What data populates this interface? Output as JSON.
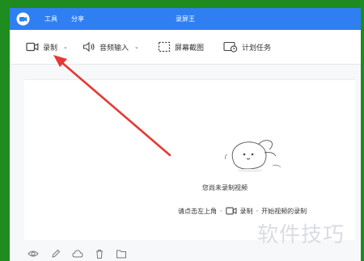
{
  "titlebar": {
    "menu": [
      "工具",
      "分享"
    ],
    "title": "录屏王"
  },
  "toolbar": {
    "record_label": "录制",
    "audio_label": "音频输入",
    "screenshot_label": "屏幕截图",
    "schedule_label": "计划任务"
  },
  "empty_state": {
    "title": "您尚未录制视频",
    "hint_prefix": "请点击左上角",
    "hint_button": "录制",
    "hint_suffix": "开始视频的录制"
  },
  "watermark": "软件技巧",
  "colors": {
    "titlebar": "#2f7ff2",
    "annotation_arrow": "#e53935",
    "desktop": "#1f8a1f"
  }
}
